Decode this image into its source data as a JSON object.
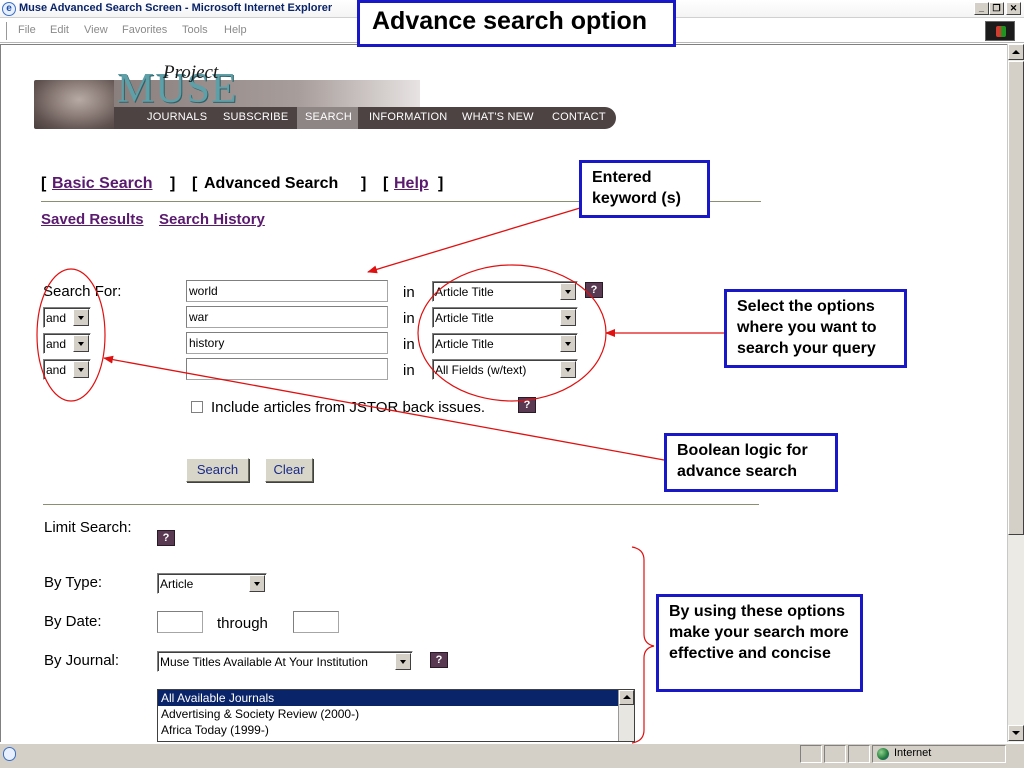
{
  "window": {
    "title": "Muse Advanced Search Screen - Microsoft Internet Explorer",
    "menu": [
      "File",
      "Edit",
      "View",
      "Favorites",
      "Tools",
      "Help"
    ],
    "buttons": {
      "minimize": "_",
      "restore": "❐",
      "close": "✕"
    }
  },
  "banner": {
    "brand_project": "Project",
    "brand_muse": "MUSE",
    "nav": [
      "JOURNALS",
      "SUBSCRIBE",
      "SEARCH",
      "INFORMATION",
      "WHAT'S NEW",
      "CONTACT"
    ],
    "active_nav": "SEARCH"
  },
  "tabs": {
    "open_bracket": "[",
    "close_bracket": "]",
    "basic": "Basic Search",
    "advanced": "Advanced Search",
    "help": "Help"
  },
  "links": {
    "saved_results": "Saved Results",
    "search_history": "Search History"
  },
  "search": {
    "label": "Search For:",
    "in_label": "in",
    "rows": [
      {
        "operator": "",
        "term": "world",
        "field": "Article Title"
      },
      {
        "operator": "and",
        "term": "war",
        "field": "Article Title"
      },
      {
        "operator": "and",
        "term": "history",
        "field": "Article Title"
      },
      {
        "operator": "and",
        "term": "",
        "field": "All Fields (w/text)"
      }
    ],
    "jstor_label": "Include articles from JSTOR back issues.",
    "jstor_checked": false,
    "search_button": "Search",
    "clear_button": "Clear",
    "help_glyph": "?"
  },
  "limit": {
    "label": "Limit Search:",
    "by_type_label": "By Type:",
    "type_value": "Article",
    "by_date_label": "By Date:",
    "date_from": "",
    "through_label": "through",
    "date_to": "",
    "by_journal_label": "By Journal:",
    "journal_value": "Muse Titles Available At Your Institution",
    "journal_list": [
      "All Available Journals",
      "Advertising & Society Review (2000-)",
      "Africa Today (1999-)"
    ],
    "journal_list_selected": 0
  },
  "status": {
    "zone": "Internet"
  },
  "annotations": {
    "title": "Advance search option",
    "keywords": "Entered keyword (s)",
    "options": "Select the options where you want to search your query",
    "boolean": "Boolean logic for advance search",
    "limits": "By using these options make your search more effective and concise",
    "arrow_color": "#e01010",
    "box_color": "#1818c8"
  }
}
